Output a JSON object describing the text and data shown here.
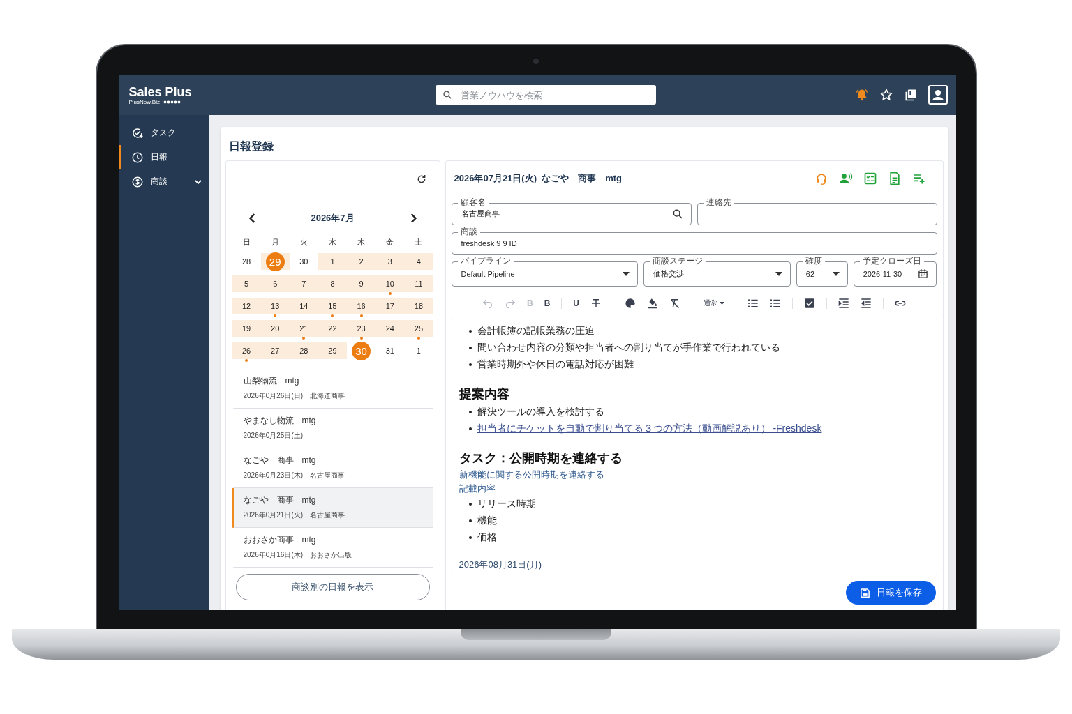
{
  "app": {
    "logo": "Sales Plus",
    "logo_sub": "PlusNow.Biz",
    "search": {
      "placeholder": "営業ノウハウを検索"
    }
  },
  "sidebar": {
    "items": [
      {
        "label": "タスク",
        "kind": "task",
        "selected": false
      },
      {
        "label": "日報",
        "kind": "report",
        "selected": true
      },
      {
        "label": "商談",
        "kind": "deal",
        "selected": false,
        "expanded": false
      }
    ]
  },
  "page": {
    "title": "日報登録"
  },
  "calendar": {
    "month": "2026年7月",
    "weekdays": [
      "日",
      "月",
      "火",
      "水",
      "木",
      "金",
      "土"
    ],
    "weeks": [
      [
        {
          "label": "28",
          "shaded": false,
          "dot": false,
          "selected": false
        },
        {
          "label": "29",
          "shaded": true,
          "dot": false,
          "selected": true
        },
        {
          "label": "30",
          "shaded": false,
          "dot": false,
          "selected": false
        },
        {
          "label": "1",
          "shaded": true,
          "dot": false,
          "selected": false
        },
        {
          "label": "2",
          "shaded": true,
          "dot": false,
          "selected": false
        },
        {
          "label": "3",
          "shaded": true,
          "dot": false,
          "selected": false
        },
        {
          "label": "4",
          "shaded": true,
          "dot": false,
          "selected": false
        }
      ],
      [
        {
          "label": "5",
          "shaded": true,
          "dot": false,
          "selected": false
        },
        {
          "label": "6",
          "shaded": true,
          "dot": false,
          "selected": false
        },
        {
          "label": "7",
          "shaded": true,
          "dot": false,
          "selected": false
        },
        {
          "label": "8",
          "shaded": true,
          "dot": false,
          "selected": false
        },
        {
          "label": "9",
          "shaded": true,
          "dot": false,
          "selected": false
        },
        {
          "label": "10",
          "shaded": true,
          "dot": true,
          "selected": false
        },
        {
          "label": "11",
          "shaded": true,
          "dot": false,
          "selected": false
        }
      ],
      [
        {
          "label": "12",
          "shaded": true,
          "dot": false,
          "selected": false
        },
        {
          "label": "13",
          "shaded": true,
          "dot": true,
          "selected": false
        },
        {
          "label": "14",
          "shaded": true,
          "dot": false,
          "selected": false
        },
        {
          "label": "15",
          "shaded": true,
          "dot": true,
          "selected": false
        },
        {
          "label": "16",
          "shaded": true,
          "dot": true,
          "selected": false
        },
        {
          "label": "17",
          "shaded": true,
          "dot": false,
          "selected": false
        },
        {
          "label": "18",
          "shaded": true,
          "dot": false,
          "selected": false
        }
      ],
      [
        {
          "label": "19",
          "shaded": true,
          "dot": false,
          "selected": false
        },
        {
          "label": "20",
          "shaded": true,
          "dot": false,
          "selected": false
        },
        {
          "label": "21",
          "shaded": true,
          "dot": true,
          "selected": false
        },
        {
          "label": "22",
          "shaded": true,
          "dot": false,
          "selected": false
        },
        {
          "label": "23",
          "shaded": true,
          "dot": true,
          "selected": false
        },
        {
          "label": "24",
          "shaded": true,
          "dot": false,
          "selected": false
        },
        {
          "label": "25",
          "shaded": true,
          "dot": true,
          "selected": false
        }
      ],
      [
        {
          "label": "26",
          "shaded": true,
          "dot": true,
          "selected": false
        },
        {
          "label": "27",
          "shaded": true,
          "dot": false,
          "selected": false
        },
        {
          "label": "28",
          "shaded": true,
          "dot": false,
          "selected": false
        },
        {
          "label": "29",
          "shaded": true,
          "dot": false,
          "selected": false
        },
        {
          "label": "30",
          "shaded": false,
          "dot": false,
          "selected": true
        },
        {
          "label": "31",
          "shaded": false,
          "dot": false,
          "selected": false
        },
        {
          "label": "1",
          "shaded": false,
          "dot": false,
          "selected": false
        }
      ]
    ]
  },
  "reports": [
    {
      "title": "山梨物流　mtg",
      "detail": "2026年0月26日(日)　北海道商事",
      "selected": false
    },
    {
      "title": "やまなし物流　mtg",
      "detail": "2026年0月25日(土)",
      "selected": false
    },
    {
      "title": "なごや　商事　mtg",
      "detail": "2026年0月23日(木)　名古屋商事",
      "selected": false
    },
    {
      "title": "なごや　商事　mtg",
      "detail": "2026年0月21日(火)　名古屋商事",
      "selected": true
    },
    {
      "title": "おおさか商事　mtg",
      "detail": "2026年0月16日(木)　おおさか出版",
      "selected": false
    }
  ],
  "deal_reports_button": "商談別の日報を表示",
  "report": {
    "title": "2026年07月21日(火)  なごや　商事　mtg",
    "field_rows": [
      [
        {
          "label": "顧客名",
          "value": "名古屋商事",
          "kind": "search"
        },
        {
          "label": "連絡先",
          "kind": "text"
        }
      ],
      [
        {
          "label": "商談",
          "value": "freshdesk 9 9 ID",
          "kind": "text"
        }
      ],
      [
        {
          "label": "パイプライン",
          "value": "Default Pipeline",
          "kind": "select"
        },
        {
          "label": "商談ステージ",
          "value": "価格交渉",
          "kind": "select"
        },
        {
          "label": "確度",
          "value": "62",
          "kind": "select"
        },
        {
          "label": "予定クローズ日",
          "value": "2026-11-30",
          "kind": "date"
        }
      ]
    ],
    "toolbar": [
      [
        {
          "kind": "undo",
          "disabled": true
        },
        {
          "kind": "redo",
          "disabled": true
        },
        {
          "kind": "bold",
          "label": "B",
          "disabled": true
        },
        {
          "kind": "bold",
          "label": "B",
          "disabled": false
        }
      ],
      [
        {
          "kind": "underline",
          "label": "U",
          "disabled": false
        },
        {
          "kind": "strike",
          "disabled": false
        }
      ],
      [
        {
          "kind": "palette",
          "disabled": false
        },
        {
          "kind": "fill",
          "disabled": false
        },
        {
          "kind": "clear",
          "disabled": false
        }
      ],
      [
        {
          "kind": "select",
          "label": "通常",
          "disabled": false
        }
      ],
      [
        {
          "kind": "bullets",
          "disabled": false
        },
        {
          "kind": "numbers",
          "disabled": false
        }
      ],
      [
        {
          "kind": "check",
          "disabled": false
        }
      ],
      [
        {
          "kind": "indent",
          "disabled": false
        },
        {
          "kind": "outdent",
          "disabled": false
        }
      ],
      [
        {
          "kind": "link",
          "disabled": false
        }
      ]
    ],
    "content": [
      {
        "kind": "bullet",
        "text": "会計帳簿の記帳業務の圧迫"
      },
      {
        "kind": "bullet",
        "text": "問い合わせ内容の分類や担当者への割り当てが手作業で行われている"
      },
      {
        "kind": "bullet",
        "text": "営業時期外や休日の電話対応が困難"
      },
      {
        "kind": "heading",
        "text": "提案内容"
      },
      {
        "kind": "bullet",
        "text": "解決ツールの導入を検討する"
      },
      {
        "kind": "link",
        "text": "担当者にチケットを自動で割り当てる３つの方法（動画解説あり） -Freshdesk"
      },
      {
        "kind": "heading",
        "text": "タスク：公開時期を連絡する"
      },
      {
        "kind": "note",
        "text": "新機能に関する公開時期を連絡する"
      },
      {
        "kind": "note",
        "text": "記載内容"
      },
      {
        "kind": "bullet",
        "text": "リリース時期"
      },
      {
        "kind": "bullet",
        "text": "機能"
      },
      {
        "kind": "bullet",
        "text": "価格"
      },
      {
        "kind": "date",
        "text": "2026年08月31日(月)"
      }
    ],
    "save_button": "日報を保存"
  }
}
